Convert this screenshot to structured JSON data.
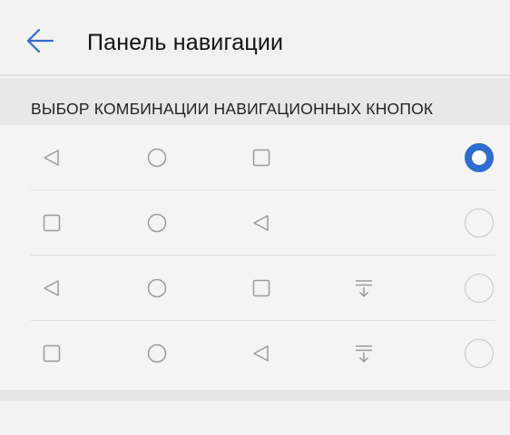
{
  "header": {
    "title": "Панель навигации",
    "back_icon": "arrow-left-icon",
    "accent_color": "#2f6cd0"
  },
  "section": {
    "label": "ВЫБОР КОМБИНАЦИИ НАВИГАЦИОННЫХ КНОПОК"
  },
  "options": [
    {
      "icons": [
        "back-triangle-icon",
        "home-circle-icon",
        "recents-square-icon"
      ],
      "selected": true
    },
    {
      "icons": [
        "recents-square-icon",
        "home-circle-icon",
        "back-triangle-icon"
      ],
      "selected": false
    },
    {
      "icons": [
        "back-triangle-icon",
        "home-circle-icon",
        "recents-square-icon",
        "notification-pull-down-icon"
      ],
      "selected": false
    },
    {
      "icons": [
        "recents-square-icon",
        "home-circle-icon",
        "back-triangle-icon",
        "notification-pull-down-icon"
      ],
      "selected": false
    }
  ],
  "colors": {
    "icon_gray": "#9a9a9a",
    "radio_selected": "#2f6cd0",
    "radio_unselected": "#c4c4c4"
  }
}
